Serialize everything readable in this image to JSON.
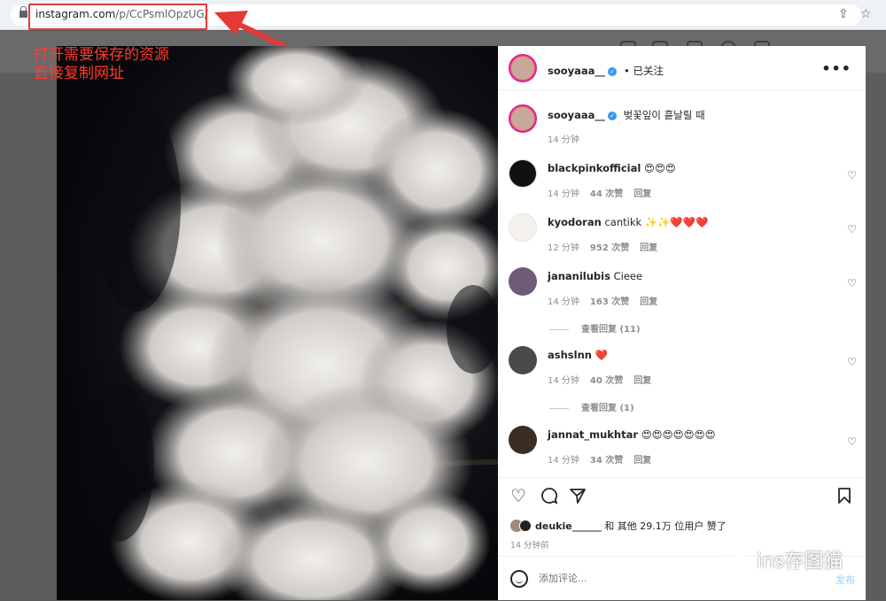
{
  "browser": {
    "url_host": "instagram.com",
    "url_path": "/p/CcPsmlOpzUG/"
  },
  "annotation": {
    "line1": "打开需要保存的资源",
    "line2": "直接复制网址"
  },
  "post": {
    "author": "sooyaaa__",
    "follow_status": "• 已关注",
    "caption": "벚꽃잎이 흩날릴 때",
    "caption_time": "14 分钟",
    "comments": [
      {
        "user": "blackpinkofficial",
        "text": "😍😍😍",
        "time": "14 分钟",
        "likes": "44 次赞",
        "reply": "回复"
      },
      {
        "user": "kyodoran",
        "text": "cantikk ✨✨❤️❤️❤️",
        "time": "12 分钟",
        "likes": "952 次赞",
        "reply": "回复"
      },
      {
        "user": "jananilubis",
        "text": "Cieee",
        "time": "14 分钟",
        "likes": "163 次赞",
        "reply": "回复",
        "view_replies": "查看回复 (11)"
      },
      {
        "user": "ashslnn",
        "text": "❤️",
        "time": "14 分钟",
        "likes": "40 次赞",
        "reply": "回复",
        "view_replies": "查看回复 (1)"
      },
      {
        "user": "jannat_mukhtar",
        "text": "😍😍😍😍😍😍😍",
        "time": "14 分钟",
        "likes": "34 次赞",
        "reply": "回复"
      }
    ],
    "liked_by_user": "deukie______",
    "liked_by_rest": " 和 其他 29.1万 位用户 赞了",
    "posted_time": "14 分钟前",
    "comment_placeholder": "添加评论...",
    "post_button": "发布"
  },
  "watermark": "ins存图猫",
  "colors": {
    "annotation_red": "#e53935",
    "verified_blue": "#3897f0",
    "post_button": "#b2dffc"
  },
  "icons": [
    "lock-icon",
    "share-icon",
    "star-icon",
    "more-icon",
    "verified-icon",
    "heart-icon",
    "comment-icon",
    "send-icon",
    "bookmark-icon",
    "emoji-icon",
    "wechat-icon"
  ]
}
